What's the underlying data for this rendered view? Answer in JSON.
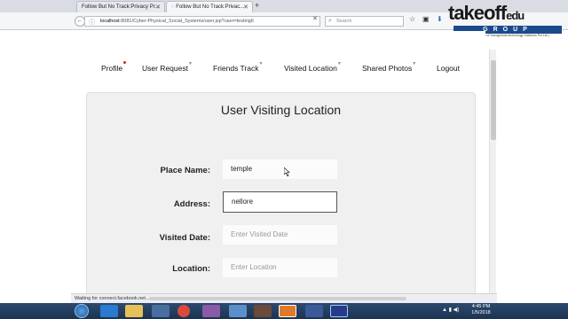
{
  "browser": {
    "tabs": [
      {
        "title": "Follow But No Track:Privacy Pr..."
      },
      {
        "title": "Follow But No Track:Privac..."
      }
    ],
    "url_host": "localhost",
    "url_rest": ":8081/Cyber-Physical_Social_Systems/user.jsp?user=testing6",
    "search_placeholder": "Search"
  },
  "logo": {
    "main": "takeoff",
    "edu": "edu",
    "group": "GROUP",
    "sub": "( A Division of Youngminds technology Solutions Pvt Ltd )"
  },
  "menu": [
    {
      "label": "Profile"
    },
    {
      "label": "User Request"
    },
    {
      "label": "Friends Track"
    },
    {
      "label": "Visited Location"
    },
    {
      "label": "Shared Photos"
    },
    {
      "label": "Logout"
    }
  ],
  "form": {
    "title": "User Visiting Location",
    "place_label": "Place Name:",
    "place_value": "temple",
    "address_label": "Address:",
    "address_value": "nellore",
    "date_label": "Visited Date:",
    "date_placeholder": "Enter Visited Date",
    "location_label": "Location:",
    "location_placeholder": "Enter Location"
  },
  "status": "Waiting for connect.facebook.net...",
  "clock": {
    "time": "4:45 PM",
    "date": "1/5/2018"
  },
  "colors": {
    "accent": "#1b4a8c",
    "panel": "#f0f0f0",
    "taskbar": "#1c3352"
  }
}
